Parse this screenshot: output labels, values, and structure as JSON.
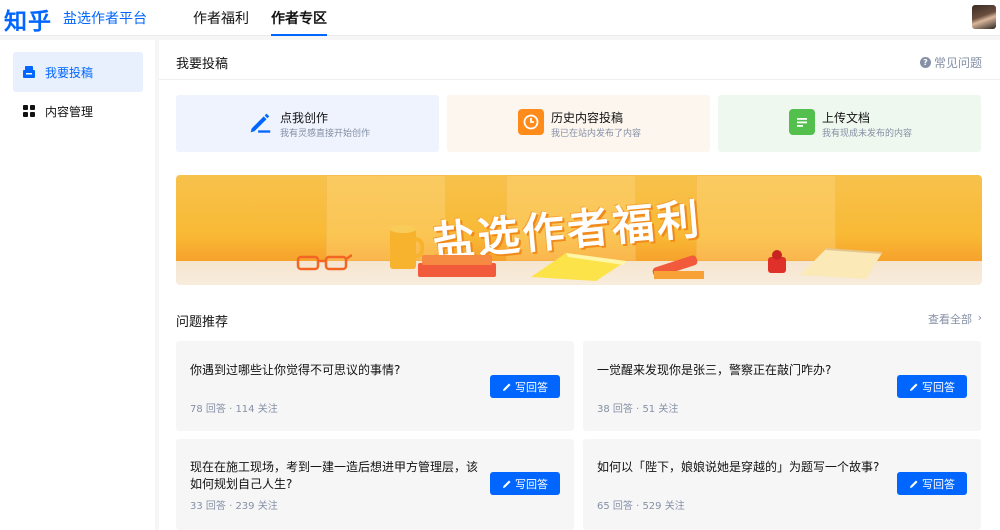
{
  "header": {
    "logo": "知乎",
    "platform": "盐选作者平台",
    "nav": [
      "作者福利",
      "作者专区"
    ]
  },
  "sidebar": {
    "items": [
      {
        "label": "我要投稿",
        "icon": "submit-icon",
        "active": true
      },
      {
        "label": "内容管理",
        "icon": "grid-icon",
        "active": false
      }
    ]
  },
  "main": {
    "title": "我要投稿",
    "faq": "常见问题",
    "cards": [
      {
        "title": "点我创作",
        "sub": "我有灵感直接开始创作",
        "icon": "pen-icon",
        "color": "#0066ff"
      },
      {
        "title": "历史内容投稿",
        "sub": "我已在站内发布了内容",
        "icon": "clock-icon",
        "color": "#ff8c1a"
      },
      {
        "title": "上传文档",
        "sub": "我有现成未发布的内容",
        "icon": "document-icon",
        "color": "#53c04d"
      }
    ],
    "banner": {
      "text": "盐选作者福利"
    },
    "recommend": {
      "title": "问题推荐",
      "view_all": "查看全部",
      "answer_label": "写回答",
      "questions": [
        {
          "text": "你遇到过哪些让你觉得不可思议的事情?",
          "meta": "78 回答 · 114 关注"
        },
        {
          "text": "一觉醒来发现你是张三，警察正在敲门咋办?",
          "meta": "38 回答 · 51 关注"
        },
        {
          "text": "现在在施工现场，考到一建一造后想进甲方管理层，该如何规划自己人生?",
          "meta": "33 回答 · 239 关注"
        },
        {
          "text": "如何以「陛下，娘娘说她是穿越的」为题写一个故事?",
          "meta": "65 回答 · 529 关注"
        }
      ]
    }
  }
}
